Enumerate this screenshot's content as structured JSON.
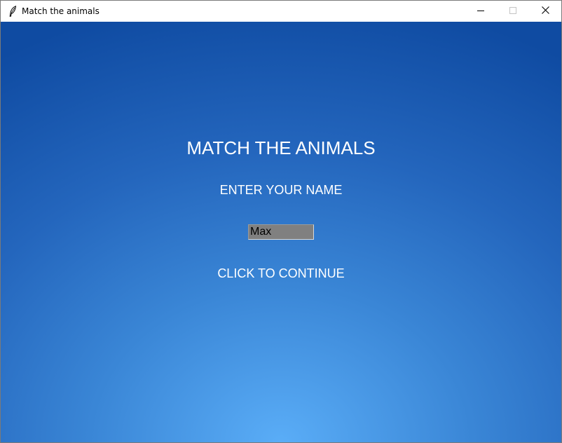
{
  "window": {
    "title": "Match the animals",
    "icon": "feather-icon",
    "controls": [
      "minimize-icon",
      "maximize-icon",
      "close-icon"
    ]
  },
  "screen": {
    "title": "MATCH THE ANIMALS",
    "prompt": "ENTER YOUR NAME",
    "name_value": "Max",
    "continue_label": "CLICK TO CONTINUE"
  },
  "colors": {
    "background_top": "#0f4ba2",
    "background_bottom_glow": "#5aadf7",
    "text": "#ffffff",
    "input_background": "#808080"
  }
}
